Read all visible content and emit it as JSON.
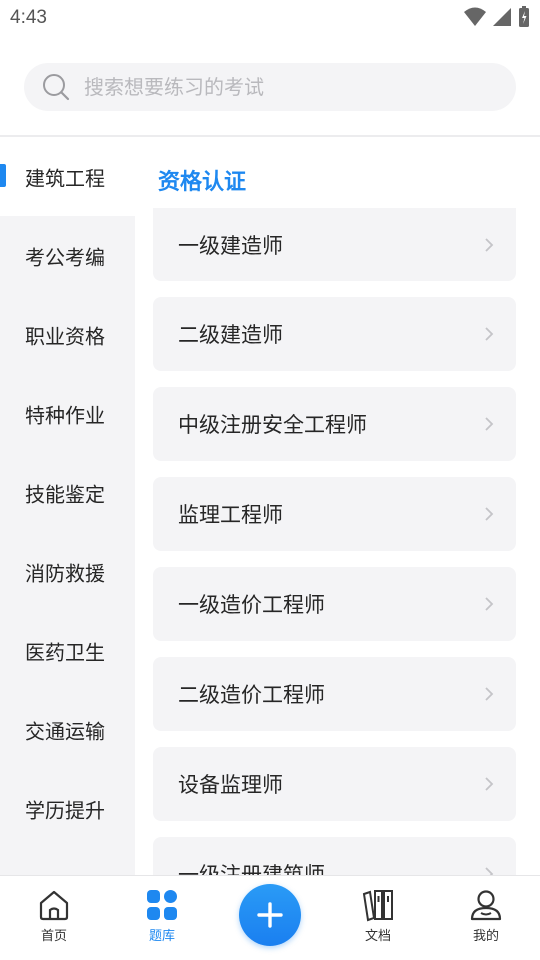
{
  "status_bar": {
    "time": "4:43"
  },
  "search": {
    "placeholder": "搜索想要练习的考试"
  },
  "sidebar": {
    "items": [
      {
        "label": "建筑工程",
        "active": true
      },
      {
        "label": "考公考编"
      },
      {
        "label": "职业资格"
      },
      {
        "label": "特种作业"
      },
      {
        "label": "技能鉴定"
      },
      {
        "label": "消防救援"
      },
      {
        "label": "医药卫生"
      },
      {
        "label": "交通运输"
      },
      {
        "label": "学历提升"
      }
    ]
  },
  "main": {
    "section_title": "资格认证",
    "items": [
      {
        "label": "一级建造师"
      },
      {
        "label": "二级建造师"
      },
      {
        "label": "中级注册安全工程师"
      },
      {
        "label": "监理工程师"
      },
      {
        "label": "一级造价工程师"
      },
      {
        "label": "二级造价工程师"
      },
      {
        "label": "设备监理师"
      },
      {
        "label": "一级注册建筑师"
      }
    ]
  },
  "bottom_nav": {
    "items": [
      {
        "label": "首页",
        "icon": "home-icon"
      },
      {
        "label": "题库",
        "icon": "grid-icon",
        "active": true
      },
      {
        "label": "",
        "icon": "plus-icon"
      },
      {
        "label": "文档",
        "icon": "books-icon"
      },
      {
        "label": "我的",
        "icon": "user-icon"
      }
    ]
  },
  "colors": {
    "accent": "#1e88f0",
    "panel": "#f4f4f6"
  }
}
